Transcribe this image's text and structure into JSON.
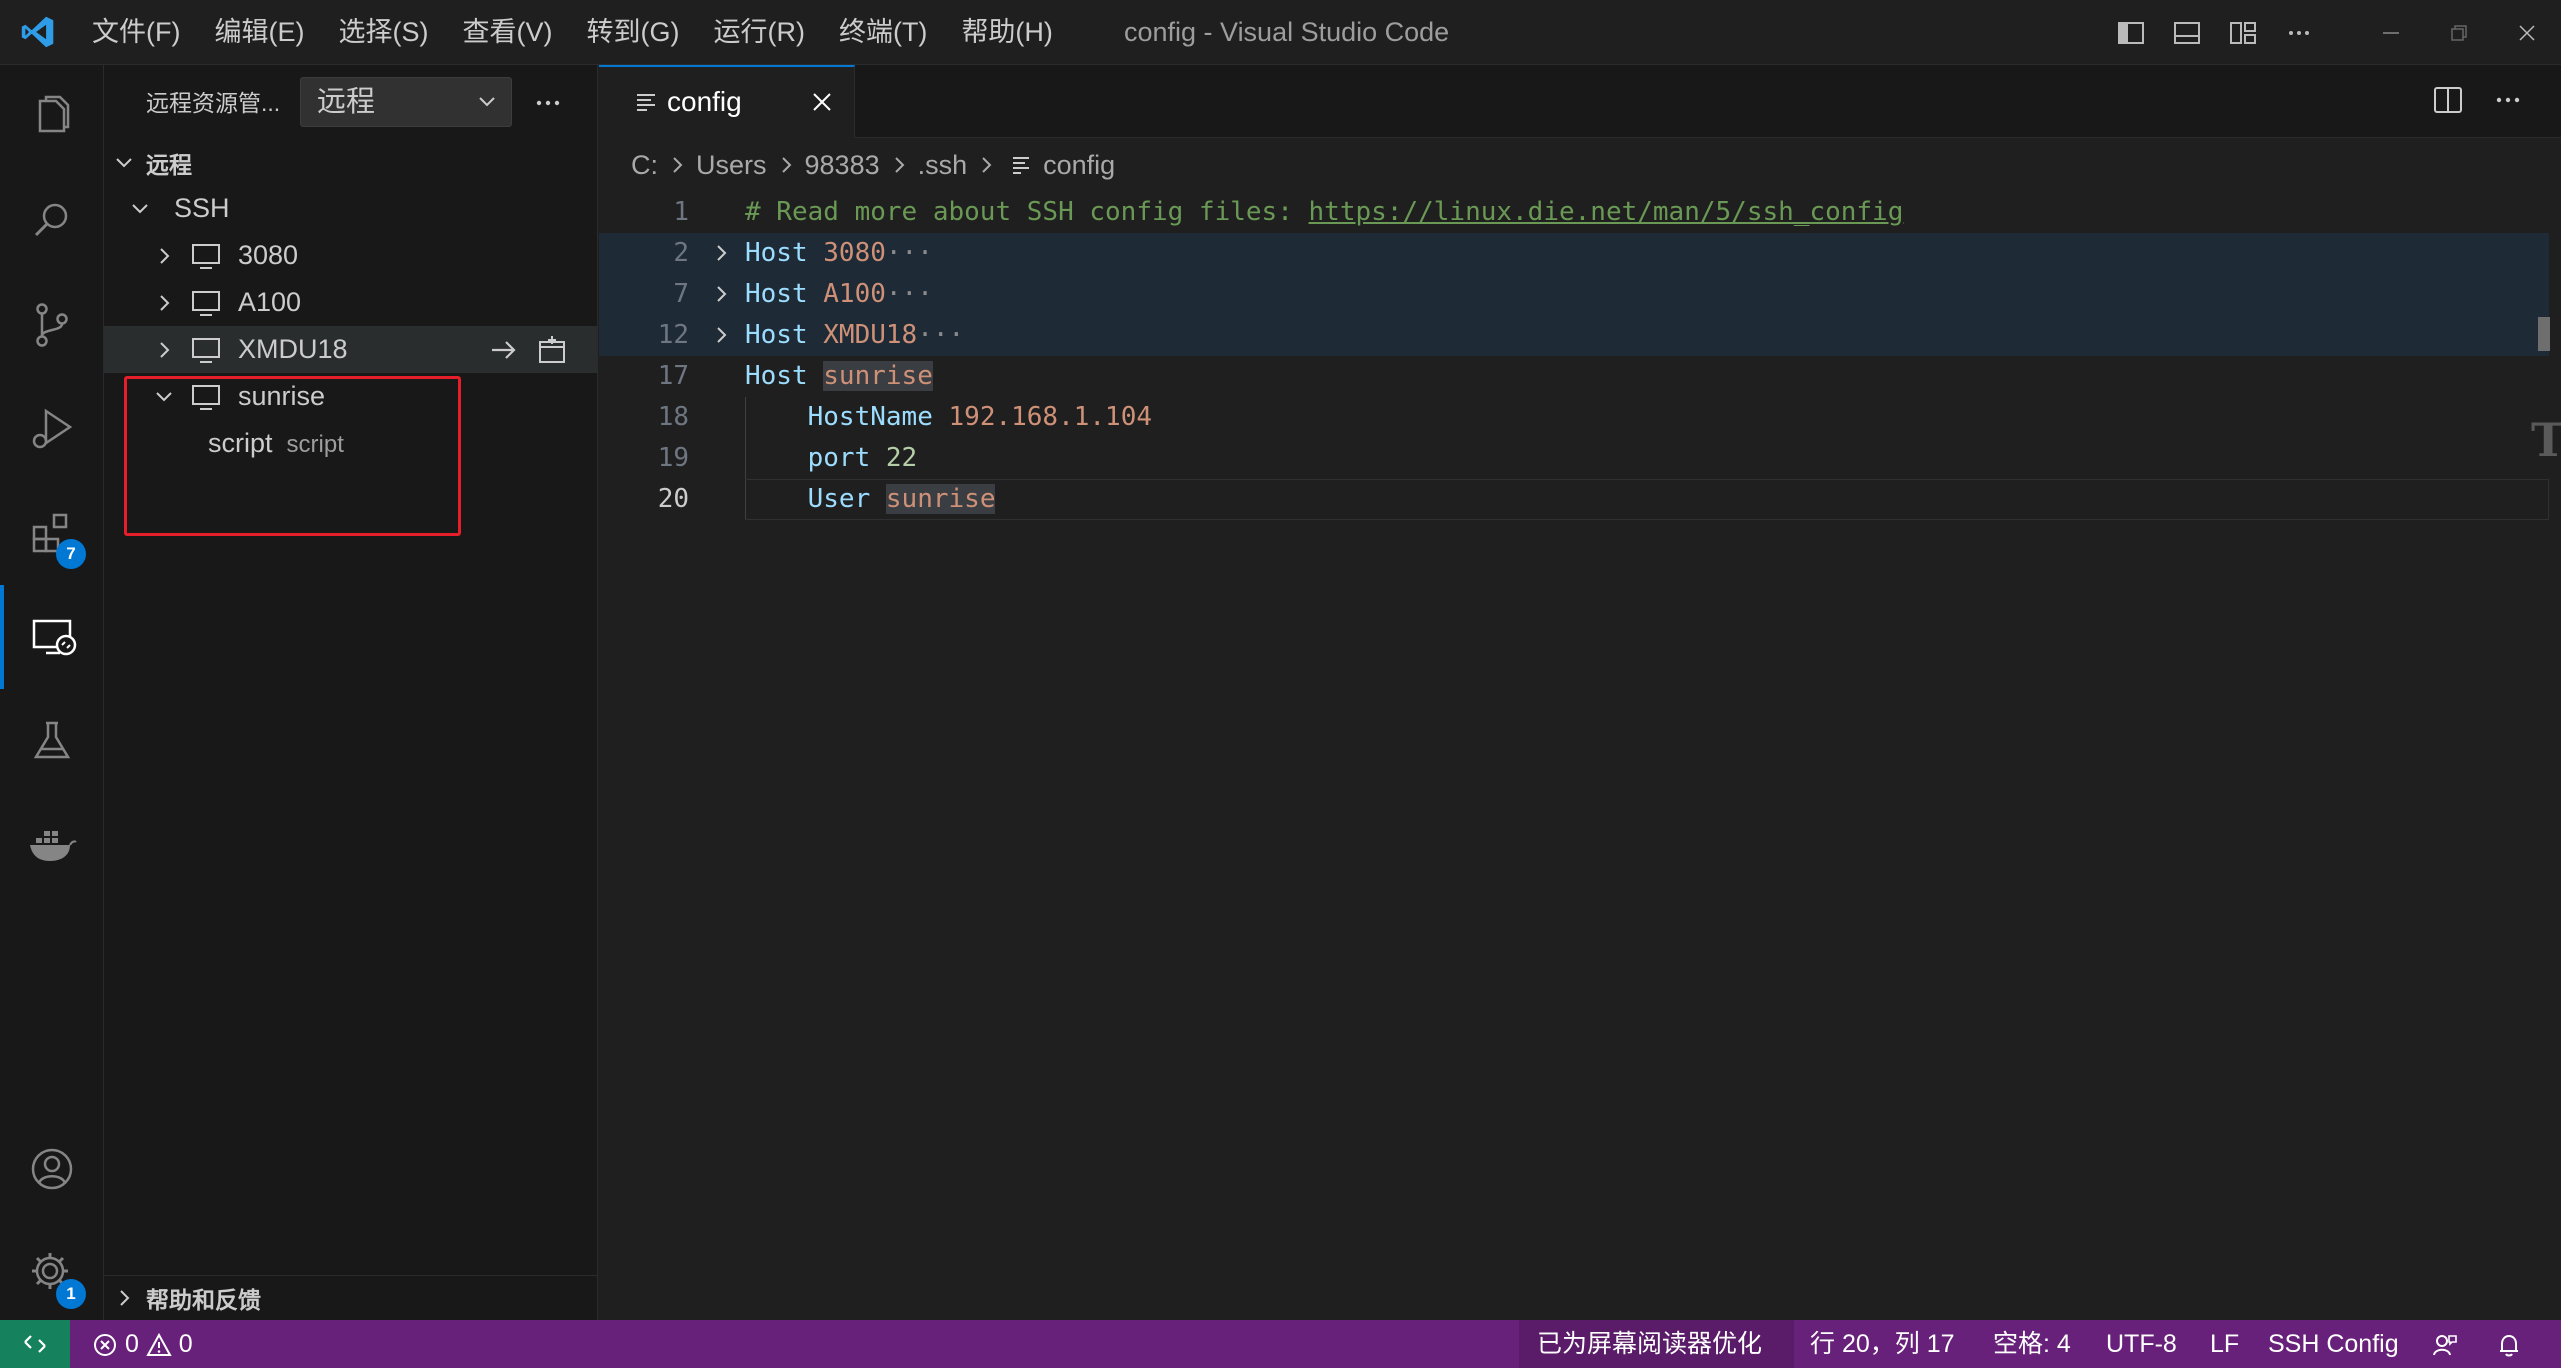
{
  "window": {
    "title": "config - Visual Studio Code",
    "menu": [
      "文件(F)",
      "编辑(E)",
      "选择(S)",
      "查看(V)",
      "转到(G)",
      "运行(R)",
      "终端(T)",
      "帮助(H)"
    ]
  },
  "activity_bar": {
    "items": [
      {
        "name": "explorer-icon"
      },
      {
        "name": "search-icon"
      },
      {
        "name": "source-control-icon"
      },
      {
        "name": "run-debug-icon"
      },
      {
        "name": "extensions-icon",
        "badge": "7"
      },
      {
        "name": "remote-explorer-icon",
        "active": true
      },
      {
        "name": "testing-icon"
      },
      {
        "name": "docker-icon"
      }
    ],
    "bottom": [
      {
        "name": "accounts-icon"
      },
      {
        "name": "settings-gear-icon",
        "badge": "1"
      }
    ]
  },
  "sidebar": {
    "title": "远程资源管...",
    "select_value": "远程",
    "section_title": "远程",
    "group": "SSH",
    "hosts": [
      {
        "label": "3080",
        "expanded": false
      },
      {
        "label": "A100",
        "expanded": false
      },
      {
        "label": "XMDU18",
        "expanded": false
      },
      {
        "label": "sunrise",
        "expanded": true
      }
    ],
    "child": {
      "label": "script",
      "description": "script"
    },
    "help_section": "帮助和反馈"
  },
  "editor": {
    "tab_label": "config",
    "breadcrumb": [
      "C:",
      "Users",
      "98383",
      ".ssh",
      "config"
    ],
    "lines": [
      {
        "n": "1"
      },
      {
        "n": "2"
      },
      {
        "n": "7"
      },
      {
        "n": "12"
      },
      {
        "n": "17"
      },
      {
        "n": "18"
      },
      {
        "n": "19"
      },
      {
        "n": "20"
      }
    ],
    "comment": "# Read more about SSH config files: ",
    "comment_link": "https://linux.die.net/man/5/ssh_config",
    "host_kw": "Host",
    "hosts_folded": [
      "3080",
      "A100",
      "XMDU18"
    ],
    "fold_ellipsis": "···",
    "host_open": "sunrise",
    "hostname_kw": "HostName",
    "hostname_val": "192.168.1.104",
    "port_kw": "port",
    "port_val": "22",
    "user_kw": "User",
    "user_val": "sunrise"
  },
  "statusbar": {
    "errors": "0",
    "warnings": "0",
    "screen_reader": "已为屏幕阅读器优化",
    "position": "行 20，列 17",
    "spaces": "空格: 4",
    "encoding": "UTF-8",
    "eol": "LF",
    "language": "SSH Config",
    "colors": {
      "background": "#68217a",
      "remote": "#16825d"
    }
  }
}
